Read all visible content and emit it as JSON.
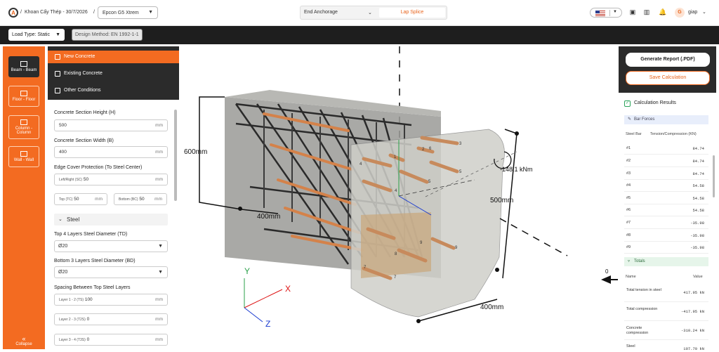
{
  "app": {
    "breadcrumb_project": "Khoan Cấy Thép - 30/7/2026",
    "project_select": "Epcon G5 Xtrem",
    "user": "giap",
    "avatar_letter": "G"
  },
  "segment": {
    "option1": "End Anchorage",
    "option2": "Lap Splice"
  },
  "toolbar": {
    "load_type": "Load Type: Static",
    "design_method": "Design Method: EN 1992-1-1"
  },
  "rail": {
    "items": [
      "Beam - Beam",
      "Floor - Floor",
      "Column - Column",
      "Wall - Wall"
    ],
    "collapse": "Collapse"
  },
  "menu": {
    "items": [
      "New Concrete",
      "Existing Concrete",
      "Other Conditions"
    ]
  },
  "form": {
    "height_label": "Concrete Section Height (H)",
    "height_value": "500",
    "unit": "mm",
    "width_label": "Concrete Section Width (B)",
    "width_value": "400",
    "cover_label": "Edge Cover Protection (To Steel Center)",
    "lr_label": "Left/Right (SC)",
    "lr_value": "50",
    "top_label": "Top (TC)",
    "top_value": "50",
    "bottom_label": "Bottom (BC)",
    "bottom_value": "50",
    "steel_label": "Steel",
    "td_label": "Top 4 Layers Steel Diameter (TD)",
    "td_value": "Ø20",
    "bd_label": "Bottom 3 Layers Steel Diameter (BD)",
    "bd_value": "Ø20",
    "spacing_label": "Spacing Between Top Steel Layers",
    "l12_label": "Layer 1 - 2 (TS)",
    "l12_value": "100",
    "l23_label": "Layer 2 - 3 (T2S)",
    "l23_value": "0",
    "l34_label": "Layer 3 - 4 (T3S)",
    "l34_value": "0"
  },
  "view": {
    "dim600": "600mm",
    "dim400a": "400mm",
    "dim500": "500mm",
    "dim400b": "400mm",
    "moment": "-148.1 kNm",
    "zero": "0",
    "ax": "X",
    "ay": "Y",
    "az": "Z",
    "nums": [
      "1",
      "2",
      "3",
      "4",
      "5",
      "6",
      "7",
      "8",
      "9",
      "4",
      "7"
    ]
  },
  "results": {
    "generate": "Generate Report (.PDF)",
    "save": "Save Calculation",
    "title": "Calculation Results",
    "bar_forces": "Bar Forces",
    "col1": "Steel Bar",
    "col2": "Tension/Compression (KN)",
    "rows": [
      [
        "#1",
        "84.74"
      ],
      [
        "#2",
        "84.74"
      ],
      [
        "#3",
        "84.74"
      ],
      [
        "#4",
        "54.58"
      ],
      [
        "#5",
        "54.58"
      ],
      [
        "#6",
        "54.58"
      ],
      [
        "#7",
        "-35.98"
      ],
      [
        "#8",
        "-35.98"
      ],
      [
        "#9",
        "-35.98"
      ]
    ],
    "totals": "Totals",
    "tname": "Name",
    "tvalue": "Value",
    "trows": [
      [
        "Total tension in steel",
        "417.95 kN"
      ],
      [
        "Total compression",
        "-417.95 kN"
      ],
      [
        "Concrete compression",
        "-310.24 kN"
      ],
      [
        "Steel",
        "107.70 kN"
      ]
    ]
  },
  "colors": {
    "accent": "#f36b21",
    "dark": "#2b2b2b"
  }
}
